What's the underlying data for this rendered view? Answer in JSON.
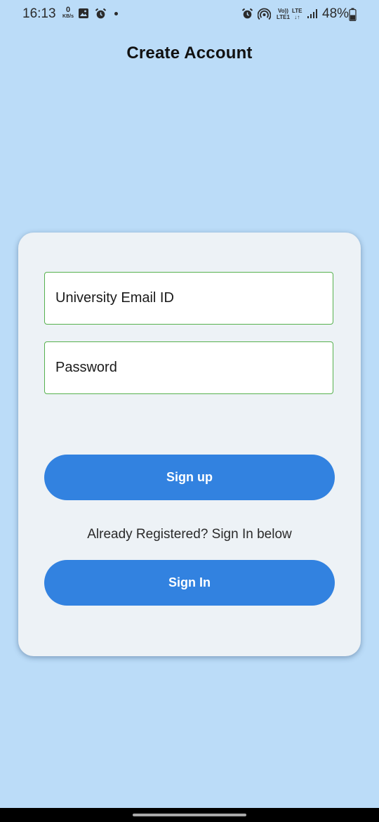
{
  "status_bar": {
    "time": "16:13",
    "net_speed_value": "0",
    "net_speed_unit": "KB/s",
    "volte_top": "Vo))",
    "volte_bottom": "LTE1",
    "lte_top": "LTE",
    "lte_bottom": "↓↑",
    "battery_percent": "48%",
    "icons": [
      "image-icon",
      "alarm-icon",
      "notification-dot",
      "alarm-icon",
      "hotspot-icon",
      "signal-icon",
      "battery-icon"
    ]
  },
  "header": {
    "title": "Create Account"
  },
  "form": {
    "email_placeholder": "University Email ID",
    "email_value": "",
    "password_placeholder": "Password",
    "password_value": "",
    "signup_label": "Sign up",
    "helper_text": "Already Registered? Sign In below",
    "signin_label": "Sign In"
  },
  "colors": {
    "background": "#bbdcf8",
    "card": "#edf2f6",
    "accent": "#3282e0",
    "field_border": "#56b14e"
  }
}
